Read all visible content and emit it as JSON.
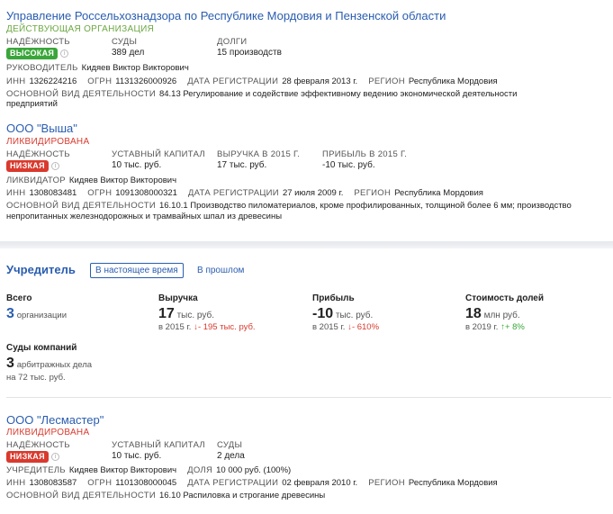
{
  "card1": {
    "title": "Управление Россельхознадзора по Республике Мордовия и Пензенской области",
    "status": "ДЕЙСТВУЮЩАЯ ОРГАНИЗАЦИЯ",
    "reliability_label": "НАДЁЖНОСТЬ",
    "reliability_badge": "ВЫСОКАЯ",
    "courts_label": "СУДЫ",
    "courts_value": "389 дел",
    "debts_label": "ДОЛГИ",
    "debts_value": "15 производств",
    "head_label": "РУКОВОДИТЕЛЬ",
    "head_value": "Кидяев Виктор Викторович",
    "inn_label": "ИНН",
    "inn_value": "1326224216",
    "ogrn_label": "ОГРН",
    "ogrn_value": "1131326000926",
    "regdate_label": "ДАТА РЕГИСТРАЦИИ",
    "regdate_value": "28 февраля 2013 г.",
    "region_label": "РЕГИОН",
    "region_value": "Республика Мордовия",
    "activity_label": "ОСНОВНОЙ ВИД ДЕЯТЕЛЬНОСТИ",
    "activity_line1": "84.13 Регулирование и содействие эффективному ведению экономической деятельности",
    "activity_line2": "предприятий"
  },
  "card2": {
    "title": "ООО \"Выша\"",
    "status": "ЛИКВИДИРОВАНА",
    "reliability_label": "НАДЁЖНОСТЬ",
    "reliability_badge": "НИЗКАЯ",
    "capital_label": "УСТАВНЫЙ КАПИТАЛ",
    "capital_value": "10 тыс. руб.",
    "revenue_label": "ВЫРУЧКА В 2015 Г.",
    "revenue_value": "17 тыс. руб.",
    "profit_label": "ПРИБЫЛЬ В 2015 Г.",
    "profit_value": "-10 тыс. руб.",
    "liquidator_label": "ЛИКВИДАТОР",
    "liquidator_value": "Кидяев Виктор Викторович",
    "inn_label": "ИНН",
    "inn_value": "1308083481",
    "ogrn_label": "ОГРН",
    "ogrn_value": "1091308000321",
    "regdate_label": "ДАТА РЕГИСТРАЦИИ",
    "regdate_value": "27 июля 2009 г.",
    "region_label": "РЕГИОН",
    "region_value": "Республика Мордовия",
    "activity_label": "ОСНОВНОЙ ВИД ДЕЯТЕЛЬНОСТИ",
    "activity_line1": "16.10.1 Производство пиломатериалов, кроме профилированных, толщиной более 6 мм; производство",
    "activity_line2": "непропитанных железнодорожных и трамвайных шпал из древесины"
  },
  "founder": {
    "title": "Учредитель",
    "tab_now": "В настоящее время",
    "tab_past": "В прошлом",
    "total_label": "Всего",
    "total_value": "3",
    "total_unit": "организации",
    "revenue_label": "Выручка",
    "revenue_value": "17",
    "revenue_unit": "тыс. руб.",
    "revenue_year": "в 2015 г.",
    "revenue_change": "↓- 195 тыс. руб.",
    "profit_label": "Прибыль",
    "profit_value": "-10",
    "profit_unit": "тыс. руб.",
    "profit_year": "в 2015 г.",
    "profit_change": "↓- 610%",
    "shares_label": "Стоимость долей",
    "shares_value": "18",
    "shares_unit": "млн руб.",
    "shares_year": "в 2019 г.",
    "shares_change": "↑+ 8%",
    "courts_label": "Суды компаний",
    "courts_value": "3",
    "courts_unit": "арбитражных дела",
    "courts_sum": "на 72 тыс. руб."
  },
  "card3": {
    "title": "ООО \"Лесмастер\"",
    "status": "ЛИКВИДИРОВАНА",
    "reliability_label": "НАДЁЖНОСТЬ",
    "reliability_badge": "НИЗКАЯ",
    "capital_label": "УСТАВНЫЙ КАПИТАЛ",
    "capital_value": "10 тыс. руб.",
    "courts_label": "СУДЫ",
    "courts_value": "2 дела",
    "founder_label": "УЧРЕДИТЕЛЬ",
    "founder_value": "Кидяев Виктор Викторович",
    "share_label": "ДОЛЯ",
    "share_value": "10 000 руб. (100%)",
    "inn_label": "ИНН",
    "inn_value": "1308083587",
    "ogrn_label": "ОГРН",
    "ogrn_value": "1101308000045",
    "regdate_label": "ДАТА РЕГИСТРАЦИИ",
    "regdate_value": "02 февраля 2010 г.",
    "region_label": "РЕГИОН",
    "region_value": "Республика Мордовия",
    "activity_label": "ОСНОВНОЙ ВИД ДЕЯТЕЛЬНОСТИ",
    "activity_line1": "16.10 Распиловка и строгание древесины"
  },
  "colors": {
    "link": "#2a5db0",
    "active": "#6ca842",
    "liquidated": "#d93a2e",
    "badge_high": "#3aa63a",
    "badge_low": "#d93a2e"
  },
  "icons": {
    "reliability_info": "info-icon",
    "down_arrow": "arrow-down-icon",
    "up_arrow": "arrow-up-icon"
  }
}
